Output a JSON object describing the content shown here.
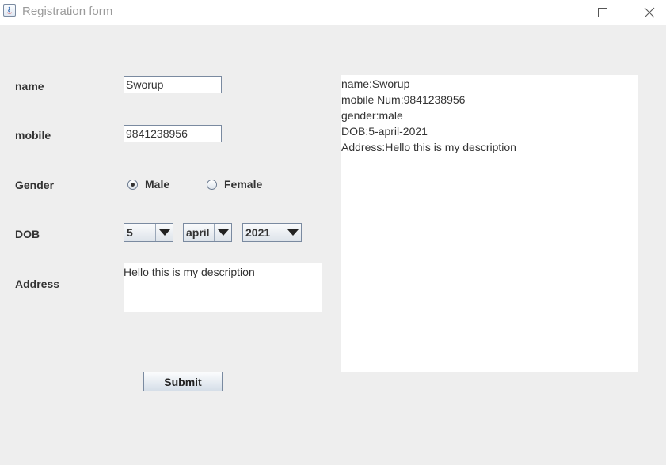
{
  "window": {
    "title": "Registration form"
  },
  "form": {
    "name_label": "name",
    "name_value": "Sworup",
    "mobile_label": "mobile",
    "mobile_value": "9841238956",
    "gender_label": "Gender",
    "gender_options": [
      "Male",
      "Female"
    ],
    "gender_selected": "Male",
    "dob_label": "DOB",
    "dob_day": "5",
    "dob_month": "april",
    "dob_year": "2021",
    "address_label": "Address",
    "address_value": "Hello this is my description",
    "submit_label": "Submit"
  },
  "output": {
    "lines": [
      "name:Sworup",
      "mobile Num:9841238956",
      "gender:male",
      "DOB:5-april-2021",
      "Address:Hello this is my description"
    ]
  }
}
